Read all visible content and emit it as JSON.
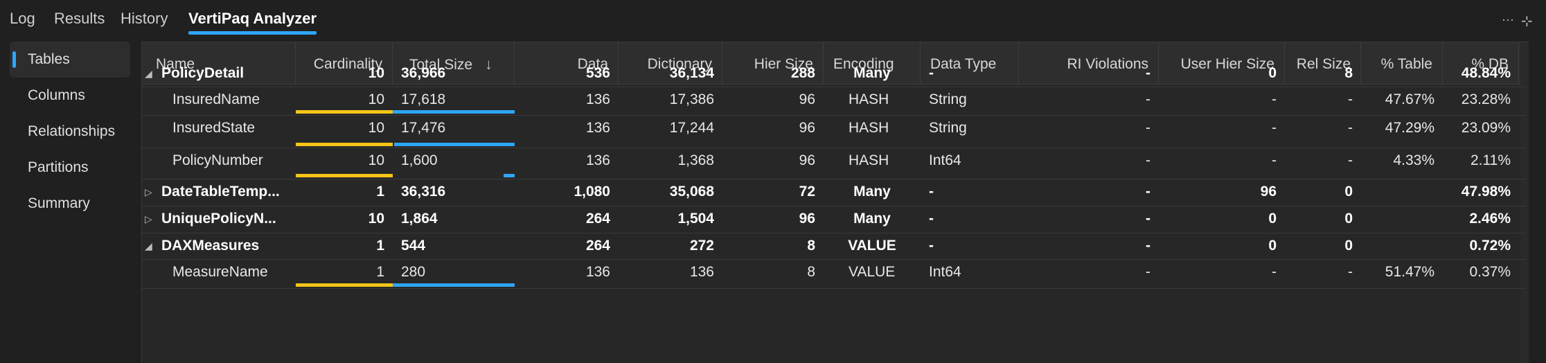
{
  "tabs": [
    "Log",
    "Results",
    "History",
    "VertiPaq Analyzer"
  ],
  "window_controls": {
    "more": "···",
    "pin": "⊹"
  },
  "sidebar": {
    "items": [
      "Tables",
      "Columns",
      "Relationships",
      "Partitions",
      "Summary"
    ]
  },
  "colors": {
    "accent": "#2ea6f7",
    "cardinality_bar": "#f5c518",
    "size_bar": "#2ea6f7"
  },
  "columns": [
    "Name",
    "Cardinality",
    "Total Size",
    "Data",
    "Dictionary",
    "Hier Size",
    "Encoding",
    "Data Type",
    "RI Violations",
    "User Hier Size",
    "Rel Size",
    "% Table",
    "% DB"
  ],
  "sort": {
    "column": "Total Size",
    "direction": "descending",
    "icon": "arrow-down-icon"
  },
  "rows": [
    {
      "kind": "table",
      "expanded": true,
      "cells": [
        "PolicyDetail",
        "10",
        "36,966",
        "536",
        "36,134",
        "288",
        "Many",
        "-",
        "-",
        "0",
        "8",
        "",
        "48.84%"
      ]
    },
    {
      "kind": "column",
      "cells": [
        "InsuredName",
        "10",
        "17,618",
        "136",
        "17,386",
        "96",
        "HASH",
        "String",
        "-",
        "-",
        "-",
        "47.67%",
        "23.28%"
      ],
      "card_bar": 1.0,
      "size_bar": 1.0
    },
    {
      "kind": "column",
      "cells": [
        "InsuredState",
        "10",
        "17,476",
        "136",
        "17,244",
        "96",
        "HASH",
        "String",
        "-",
        "-",
        "-",
        "47.29%",
        "23.09%"
      ],
      "card_bar": 1.0,
      "size_bar": 0.99
    },
    {
      "kind": "column",
      "cells": [
        "PolicyNumber",
        "10",
        "1,600",
        "136",
        "1,368",
        "96",
        "HASH",
        "Int64",
        "-",
        "-",
        "-",
        "4.33%",
        "2.11%"
      ],
      "card_bar": 1.0,
      "size_bar": 0.09
    },
    {
      "kind": "table",
      "expanded": false,
      "cells": [
        "DateTableTemp...",
        "1",
        "36,316",
        "1,080",
        "35,068",
        "72",
        "Many",
        "-",
        "-",
        "96",
        "0",
        "",
        "47.98%"
      ]
    },
    {
      "kind": "table",
      "expanded": false,
      "cells": [
        "UniquePolicyN...",
        "10",
        "1,864",
        "264",
        "1,504",
        "96",
        "Many",
        "-",
        "-",
        "0",
        "0",
        "",
        "2.46%"
      ]
    },
    {
      "kind": "table",
      "expanded": true,
      "cells": [
        "DAXMeasures",
        "1",
        "544",
        "264",
        "272",
        "8",
        "VALUE",
        "-",
        "-",
        "0",
        "0",
        "",
        "0.72%"
      ]
    },
    {
      "kind": "column",
      "cells": [
        "MeasureName",
        "1",
        "280",
        "136",
        "136",
        "8",
        "VALUE",
        "Int64",
        "-",
        "-",
        "-",
        "51.47%",
        "0.37%"
      ],
      "card_bar": 1.0,
      "size_bar": 1.0
    }
  ]
}
